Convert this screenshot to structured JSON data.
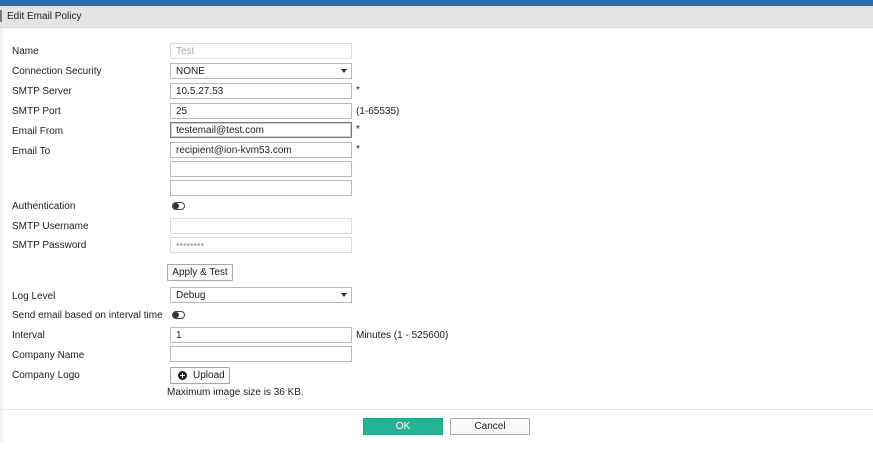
{
  "dialog": {
    "title": "Edit Email Policy"
  },
  "form": {
    "name": {
      "label": "Name",
      "value": "Test"
    },
    "connection_security": {
      "label": "Connection Security",
      "value": "NONE"
    },
    "smtp_server": {
      "label": "SMTP Server",
      "value": "10.5.27.53",
      "required": "*"
    },
    "smtp_port": {
      "label": "SMTP Port",
      "value": "25",
      "hint": "(1-65535)"
    },
    "email_from": {
      "label": "Email From",
      "value": "testemail@test.com",
      "required": "*"
    },
    "email_to": {
      "label": "Email To",
      "value": "recipient@ion-kvm53.com",
      "required": "*",
      "extra_1": "",
      "extra_2": ""
    },
    "authentication": {
      "label": "Authentication",
      "enabled": false
    },
    "smtp_username": {
      "label": "SMTP Username",
      "value": ""
    },
    "smtp_password": {
      "label": "SMTP Password",
      "value": "••••••••"
    },
    "apply_test_label": "Apply & Test",
    "log_level": {
      "label": "Log Level",
      "value": "Debug"
    },
    "send_on_interval": {
      "label": "Send email based on interval time",
      "enabled": false
    },
    "interval": {
      "label": "Interval",
      "value": "1",
      "hint": "Minutes (1 - 525600)"
    },
    "company_name": {
      "label": "Company Name",
      "value": ""
    },
    "company_logo": {
      "label": "Company Logo",
      "upload_label": "Upload",
      "note": "Maximum image size is 36 KB."
    }
  },
  "footer": {
    "ok_label": "OK",
    "cancel_label": "Cancel"
  },
  "colors": {
    "accent": "#26b394",
    "topbar": "#2b6cb0"
  },
  "icons": {
    "upload": "plus-circle-icon",
    "select": "chevron-down-icon"
  }
}
